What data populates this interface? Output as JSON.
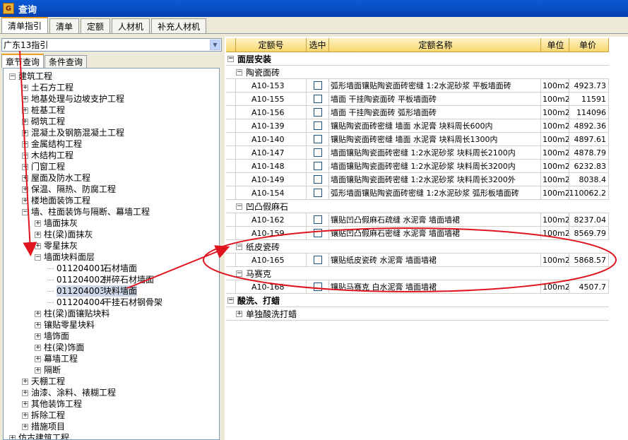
{
  "window": {
    "title": "查询"
  },
  "top_tabs": [
    "清单指引",
    "清单",
    "定额",
    "人材机",
    "补充人材机"
  ],
  "combo": {
    "value": "广东13指引"
  },
  "sub_tabs": [
    "章节查询",
    "条件查询"
  ],
  "tree": [
    {
      "t": "建筑工程",
      "lvl": 0,
      "sym": "-"
    },
    {
      "t": "土石方工程",
      "lvl": 1,
      "sym": "+"
    },
    {
      "t": "地基处理与边坡支护工程",
      "lvl": 1,
      "sym": "+"
    },
    {
      "t": "桩基工程",
      "lvl": 1,
      "sym": "+"
    },
    {
      "t": "砌筑工程",
      "lvl": 1,
      "sym": "+"
    },
    {
      "t": "混凝土及钢筋混凝土工程",
      "lvl": 1,
      "sym": "+"
    },
    {
      "t": "金属结构工程",
      "lvl": 1,
      "sym": "+"
    },
    {
      "t": "木结构工程",
      "lvl": 1,
      "sym": "+"
    },
    {
      "t": "门窗工程",
      "lvl": 1,
      "sym": "+"
    },
    {
      "t": "屋面及防水工程",
      "lvl": 1,
      "sym": "+"
    },
    {
      "t": "保温、隔热、防腐工程",
      "lvl": 1,
      "sym": "+"
    },
    {
      "t": "楼地面装饰工程",
      "lvl": 1,
      "sym": "+"
    },
    {
      "t": "墙、柱面装饰与隔断、幕墙工程",
      "lvl": 1,
      "sym": "-"
    },
    {
      "t": "墙面抹灰",
      "lvl": 2,
      "sym": "+"
    },
    {
      "t": "柱(梁)面抹灰",
      "lvl": 2,
      "sym": "+"
    },
    {
      "t": "零星抹灰",
      "lvl": 2,
      "sym": "+"
    },
    {
      "t": "墙面块料面层",
      "lvl": 2,
      "sym": "-"
    },
    {
      "t": "石材墙面",
      "code": "011204001",
      "lvl": 3,
      "sym": ""
    },
    {
      "t": "拼碎石材墙面",
      "code": "011204002",
      "lvl": 3,
      "sym": ""
    },
    {
      "t": "块料墙面",
      "code": "011204003",
      "lvl": 3,
      "sym": "",
      "selected": true
    },
    {
      "t": "干挂石材钢骨架",
      "code": "011204004",
      "lvl": 3,
      "sym": ""
    },
    {
      "t": "柱(梁)面镶贴块料",
      "lvl": 2,
      "sym": "+"
    },
    {
      "t": "镶贴零星块料",
      "lvl": 2,
      "sym": "+"
    },
    {
      "t": "墙饰面",
      "lvl": 2,
      "sym": "+"
    },
    {
      "t": "柱(梁)饰面",
      "lvl": 2,
      "sym": "+"
    },
    {
      "t": "幕墙工程",
      "lvl": 2,
      "sym": "+"
    },
    {
      "t": "隔断",
      "lvl": 2,
      "sym": "+"
    },
    {
      "t": "天棚工程",
      "lvl": 1,
      "sym": "+"
    },
    {
      "t": "油漆、涂料、裱糊工程",
      "lvl": 1,
      "sym": "+"
    },
    {
      "t": "其他装饰工程",
      "lvl": 1,
      "sym": "+"
    },
    {
      "t": "拆除工程",
      "lvl": 1,
      "sym": "+"
    },
    {
      "t": "措施项目",
      "lvl": 1,
      "sym": "+"
    },
    {
      "t": "仿古建筑工程",
      "lvl": 0,
      "sym": "+"
    }
  ],
  "grid": {
    "headers": [
      "定额号",
      "选中",
      "定额名称",
      "单位",
      "单价"
    ],
    "rows": [
      {
        "kind": "g1",
        "sym": "-",
        "name": "面层安装"
      },
      {
        "kind": "g2",
        "sym": "-",
        "name": "陶瓷面砖"
      },
      {
        "kind": "r",
        "code": "A10-153",
        "name": "弧形墙面镶贴陶瓷面砖密缝 1:2水泥砂浆 平板墙面砖",
        "unit": "100m2",
        "price": "4923.73"
      },
      {
        "kind": "r",
        "code": "A10-155",
        "name": "墙面 干挂陶瓷面砖 平板墙面砖",
        "unit": "100m2",
        "price": "11591"
      },
      {
        "kind": "r",
        "code": "A10-156",
        "name": "墙面 干挂陶瓷面砖 弧形墙面砖",
        "unit": "100m2",
        "price": "114096"
      },
      {
        "kind": "r",
        "code": "A10-139",
        "name": "镶贴陶瓷面砖密缝 墙面 水泥膏 块料周长600内",
        "unit": "100m2",
        "price": "4892.36"
      },
      {
        "kind": "r",
        "code": "A10-140",
        "name": "镶贴陶瓷面砖密缝 墙面 水泥膏 块料周长1300内",
        "unit": "100m2",
        "price": "4897.61"
      },
      {
        "kind": "r",
        "code": "A10-147",
        "name": "墙面镶贴陶瓷面砖密缝 1:2水泥砂浆 块料周长2100内",
        "unit": "100m2",
        "price": "4878.79"
      },
      {
        "kind": "r",
        "code": "A10-148",
        "name": "墙面镶贴陶瓷面砖密缝 1:2水泥砂浆 块料周长3200内",
        "unit": "100m2",
        "price": "6232.83"
      },
      {
        "kind": "r",
        "code": "A10-149",
        "name": "墙面镶贴陶瓷面砖密缝 1:2水泥砂浆 块料周长3200外",
        "unit": "100m2",
        "price": "8038.4"
      },
      {
        "kind": "r",
        "code": "A10-154",
        "name": "弧形墙面镶贴陶瓷面砖密缝 1:2水泥砂浆 弧形板墙面砖",
        "unit": "100m2",
        "price": "110062.2"
      },
      {
        "kind": "g2",
        "sym": "-",
        "name": "凹凸假麻石"
      },
      {
        "kind": "r",
        "code": "A10-162",
        "name": "镶贴凹凸假麻石疏缝 水泥膏 墙面墙裙",
        "unit": "100m2",
        "price": "8237.04"
      },
      {
        "kind": "r",
        "code": "A10-159",
        "name": "镶贴凹凸假麻石密缝 水泥膏 墙面墙裙",
        "unit": "100m2",
        "price": "8569.79"
      },
      {
        "kind": "g2",
        "sym": "-",
        "name": "纸皮瓷砖"
      },
      {
        "kind": "r",
        "code": "A10-165",
        "name": "镶贴纸皮瓷砖 水泥膏 墙面墙裙",
        "unit": "100m2",
        "price": "5868.57"
      },
      {
        "kind": "g2",
        "sym": "-",
        "name": "马赛克"
      },
      {
        "kind": "r",
        "code": "A10-168",
        "name": "镶贴马赛克 白水泥膏 墙面墙裙",
        "unit": "100m2",
        "price": "4507.7"
      },
      {
        "kind": "g1",
        "sym": "-",
        "name": "酸洗、打蜡"
      },
      {
        "kind": "g2",
        "sym": "+",
        "name": "单独酸洗打蜡"
      }
    ]
  },
  "colors": {
    "title_bar": "#0a5bd6",
    "header": "#f6d66e",
    "annotation": "#e0141e"
  }
}
